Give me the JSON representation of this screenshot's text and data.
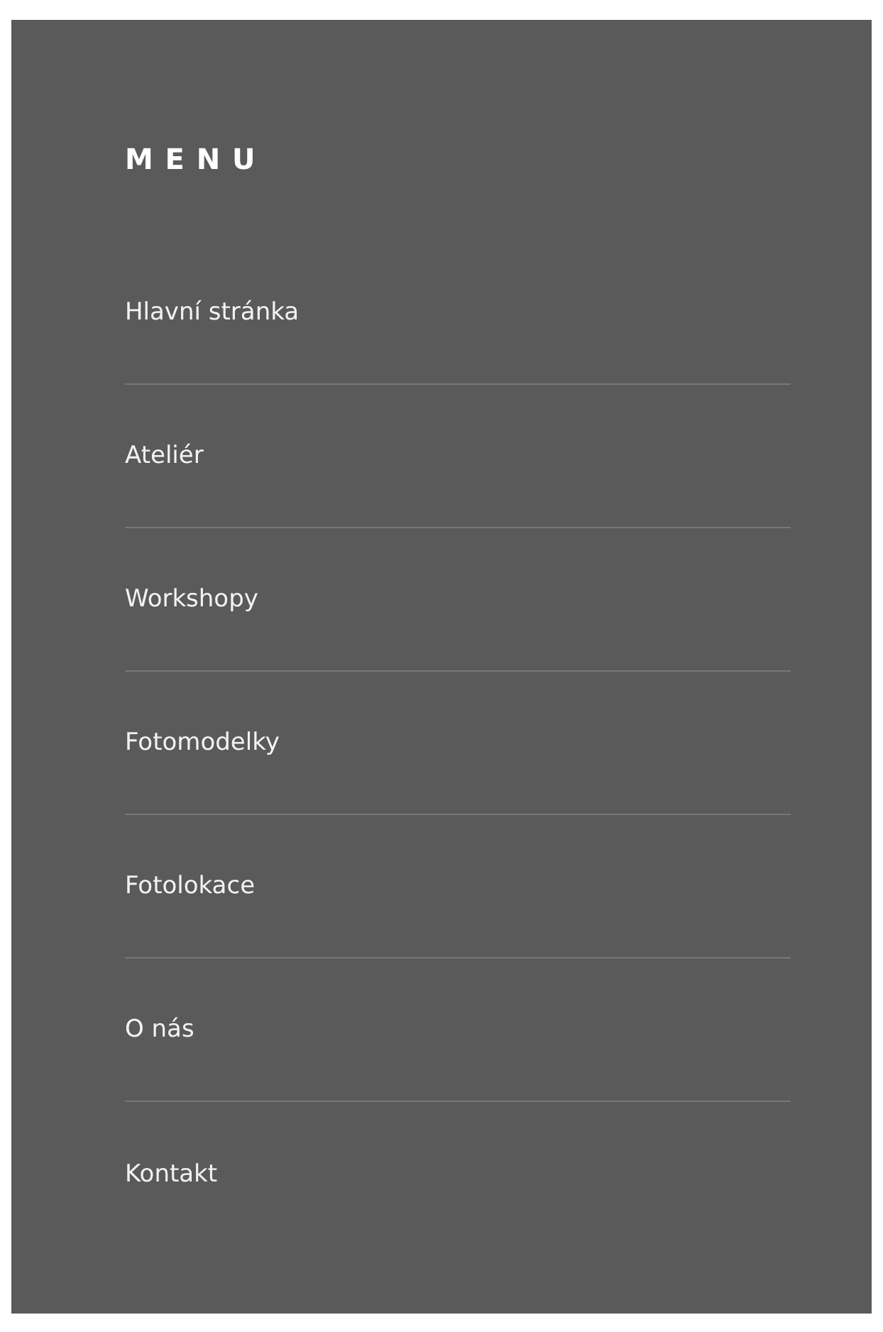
{
  "menu": {
    "title": "MENU",
    "items": [
      {
        "label": "Hlavní stránka"
      },
      {
        "label": "Ateliér"
      },
      {
        "label": "Workshopy"
      },
      {
        "label": "Fotomodelky"
      },
      {
        "label": "Fotolokace"
      },
      {
        "label": "O nás"
      },
      {
        "label": "Kontakt"
      }
    ]
  }
}
